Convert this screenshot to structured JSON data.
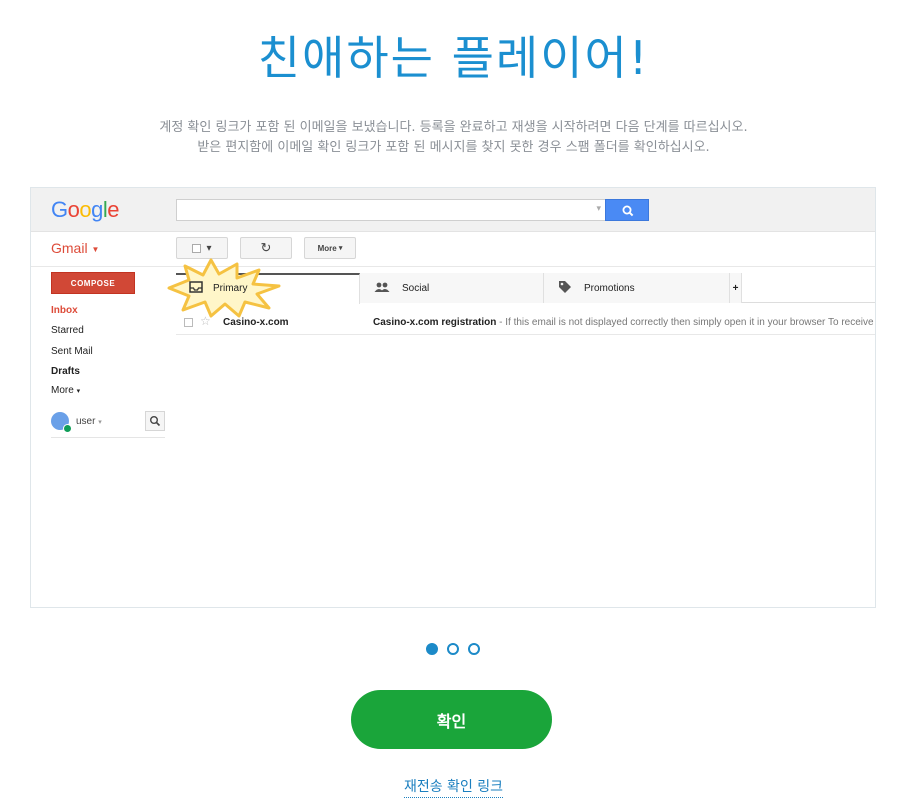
{
  "title": "친애하는 플레이어!",
  "description": {
    "line1": "계정 확인 링크가 포함 된 이메일을 보냈습니다. 등록을 완료하고 재생을 시작하려면 다음 단계를 따르십시오.",
    "line2": "받은 편지함에 이메일 확인 링크가 포함 된 메시지를 찾지 못한 경우 스팸 폴더를 확인하십시오."
  },
  "gmail_mock": {
    "logo_letters": [
      "G",
      "o",
      "o",
      "g",
      "l",
      "e"
    ],
    "app_label": "Gmail",
    "toolbar": {
      "refresh_icon": "↻",
      "more_label": "More",
      "select_caret": "▾"
    },
    "compose_label": "COMPOSE",
    "nav": [
      "Inbox",
      "Starred",
      "Sent Mail",
      "Drafts",
      "More"
    ],
    "user_label": "user",
    "tabs": [
      {
        "label": "Primary",
        "icon": "inbox-icon"
      },
      {
        "label": "Social",
        "icon": "people-icon"
      },
      {
        "label": "Promotions",
        "icon": "tag-icon"
      }
    ],
    "add_tab": "+",
    "email": {
      "sender": "Casino-x.com",
      "subject": "Casino-x.com registration",
      "snippet": " - If this email is not displayed correctly then simply open it in your browser To receive our em"
    }
  },
  "carousel": {
    "count": 3,
    "active": 0
  },
  "confirm_button": "확인",
  "resend_link": "재전송 확인 링크",
  "colors": {
    "title": "#1b8fd0",
    "confirm": "#1aa53a",
    "link": "#1b7fbf",
    "gmail_red": "#dd4b39"
  }
}
